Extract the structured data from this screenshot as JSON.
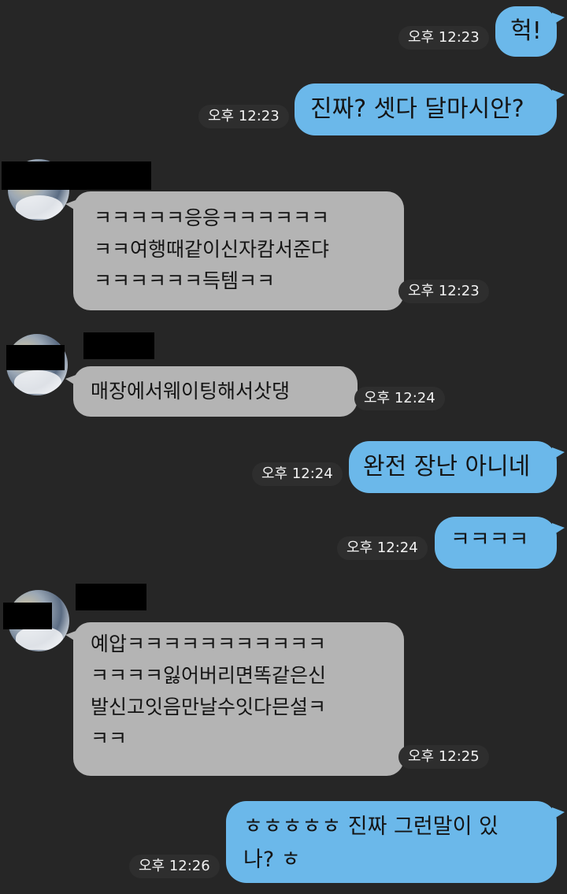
{
  "messages": [
    {
      "side": "out",
      "text": "헉!",
      "time": "오후 12:23"
    },
    {
      "side": "out",
      "text": "진짜? 셋다 달마시안?",
      "time": "오후 12:23"
    },
    {
      "side": "in",
      "text": "ㅋㅋㅋㅋㅋ응응ㅋㅋㅋㅋㅋㅋ\nㅋㅋ여행때같이신자캄서준댜\nㅋㅋㅋㅋㅋㅋ득템ㅋㅋ",
      "time": "오후 12:23"
    },
    {
      "side": "in",
      "text": "매장에서웨이팅해서삿댕",
      "time": "오후 12:24"
    },
    {
      "side": "out",
      "text": "완전 장난 아니네",
      "time": "오후 12:24"
    },
    {
      "side": "out",
      "text": "ㅋㅋㅋㅋ",
      "time": "오후 12:24"
    },
    {
      "side": "in",
      "text": "예압ㅋㅋㅋㅋㅋㅋㅋㅋㅋㅋㅋ\nㅋㅋㅋㅋ잃어버리면똑같은신\n발신고잇음만날수잇다믄설ㅋ\nㅋㅋ",
      "time": "오후 12:25"
    },
    {
      "side": "out",
      "text": "ㅎㅎㅎㅎㅎ 진짜 그런말이 있\n나? ㅎ",
      "time": "오후 12:26"
    }
  ],
  "colors": {
    "background": "#262626",
    "outgoing_bubble": "#6bb8ea",
    "incoming_bubble": "#b4b4b4",
    "redaction": "#000000"
  },
  "icons": {
    "avatar": "contact-avatar"
  }
}
